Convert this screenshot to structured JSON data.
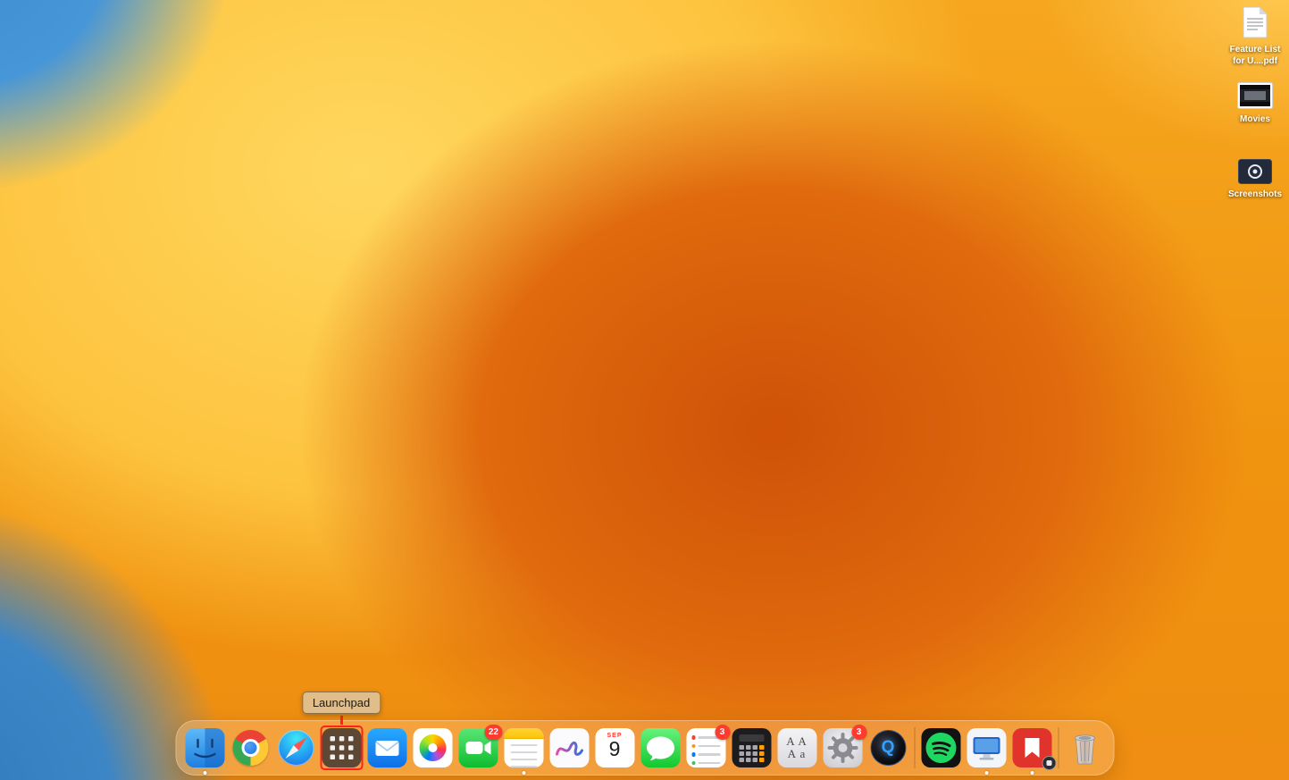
{
  "tooltip": {
    "label": "Launchpad"
  },
  "desktop_icons": [
    {
      "name": "pdf-file",
      "label": "Feature List for U....pdf"
    },
    {
      "name": "movies-file",
      "label": "Movies"
    },
    {
      "name": "screenshots-folder",
      "label": "Screenshots"
    }
  ],
  "dock": {
    "items": [
      {
        "name": "finder",
        "running": true
      },
      {
        "name": "google-chrome"
      },
      {
        "name": "safari"
      },
      {
        "name": "launchpad",
        "annotated": true
      },
      {
        "name": "mail"
      },
      {
        "name": "photos"
      },
      {
        "name": "facetime",
        "badge": "22"
      },
      {
        "name": "notes",
        "running": true
      },
      {
        "name": "freeform"
      },
      {
        "name": "calendar",
        "month": "SEP",
        "day": "9"
      },
      {
        "name": "messages"
      },
      {
        "name": "reminders",
        "badge": "3"
      },
      {
        "name": "calculator"
      },
      {
        "name": "font-book",
        "rows": [
          "A A",
          "A a"
        ]
      },
      {
        "name": "system-settings",
        "badge": "3"
      },
      {
        "name": "quicktime-player",
        "letter": "Q"
      },
      {
        "name": "spotify"
      },
      {
        "name": "monitor-app",
        "running": true
      },
      {
        "name": "red-media-app",
        "running": true
      },
      {
        "name": "trash"
      }
    ]
  },
  "colors": {
    "badge": "#ff3b30",
    "annotation": "#ff2222",
    "wallpaper_blue": "#3e8ed0",
    "wallpaper_orange": "#ef8e12"
  }
}
